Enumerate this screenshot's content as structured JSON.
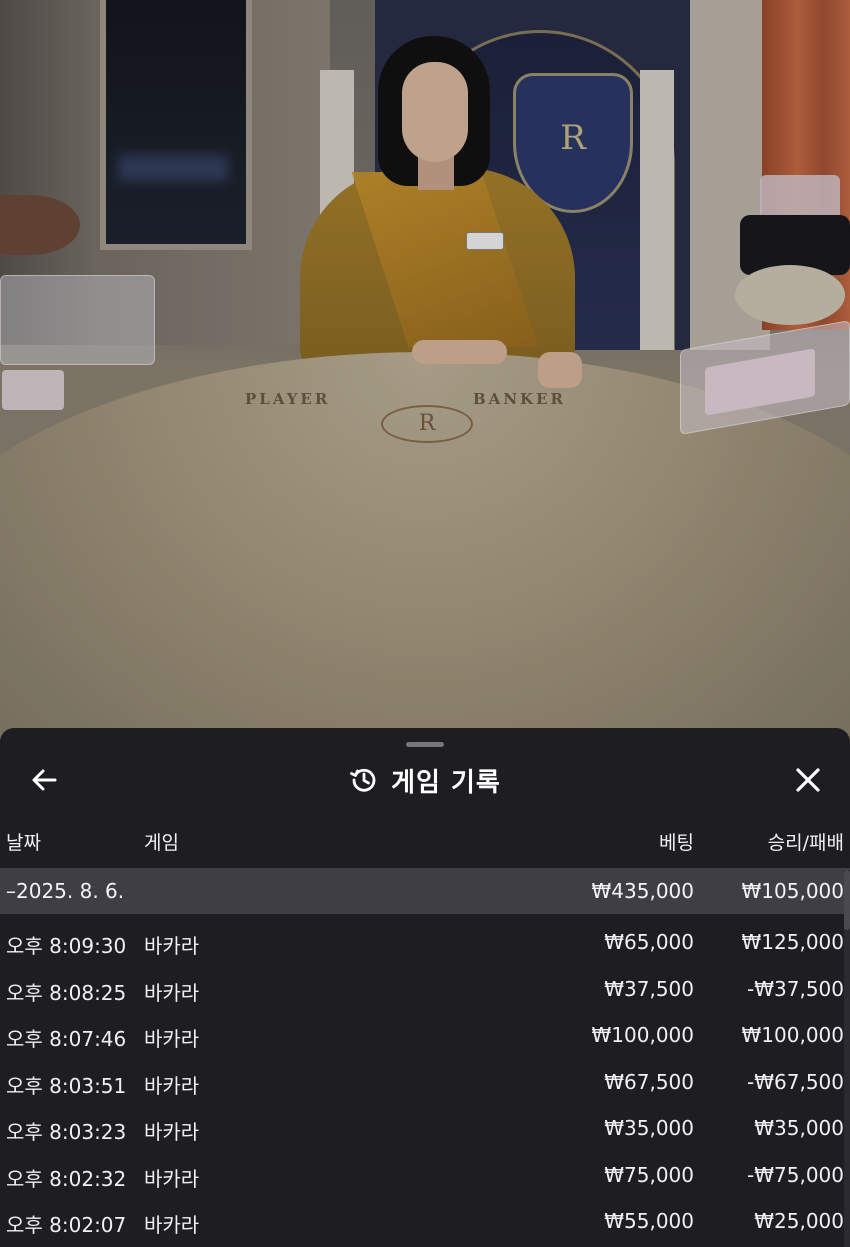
{
  "video": {
    "table_labels": {
      "player": "PLAYER",
      "banker": "BANKER"
    },
    "crest_letter": "R",
    "felt_logo_letter": "R"
  },
  "sheet": {
    "title": "게임 기록",
    "icons": {
      "back": "arrow-left-icon",
      "history": "history-icon",
      "close": "close-icon"
    },
    "columns": {
      "date": "날짜",
      "game": "게임",
      "bet": "베팅",
      "win_loss": "승리/패배"
    },
    "summary": {
      "date": "–2025. 8. 6.",
      "bet": "₩435,000",
      "win_loss": "₩105,000"
    },
    "rows": [
      {
        "time": "오후 8:09:30",
        "game": "바카라",
        "bet": "₩65,000",
        "win_loss": "₩125,000"
      },
      {
        "time": "오후 8:08:25",
        "game": "바카라",
        "bet": "₩37,500",
        "win_loss": "-₩37,500"
      },
      {
        "time": "오후 8:07:46",
        "game": "바카라",
        "bet": "₩100,000",
        "win_loss": "₩100,000"
      },
      {
        "time": "오후 8:03:51",
        "game": "바카라",
        "bet": "₩67,500",
        "win_loss": "-₩67,500"
      },
      {
        "time": "오후 8:03:23",
        "game": "바카라",
        "bet": "₩35,000",
        "win_loss": "₩35,000"
      },
      {
        "time": "오후 8:02:32",
        "game": "바카라",
        "bet": "₩75,000",
        "win_loss": "-₩75,000"
      },
      {
        "time": "오후 8:02:07",
        "game": "바카라",
        "bet": "₩55,000",
        "win_loss": "₩25,000"
      }
    ]
  },
  "colors": {
    "sheet_bg": "#1e1d22",
    "summary_bg": "#3f3e44",
    "text": "#f0f0f2"
  }
}
